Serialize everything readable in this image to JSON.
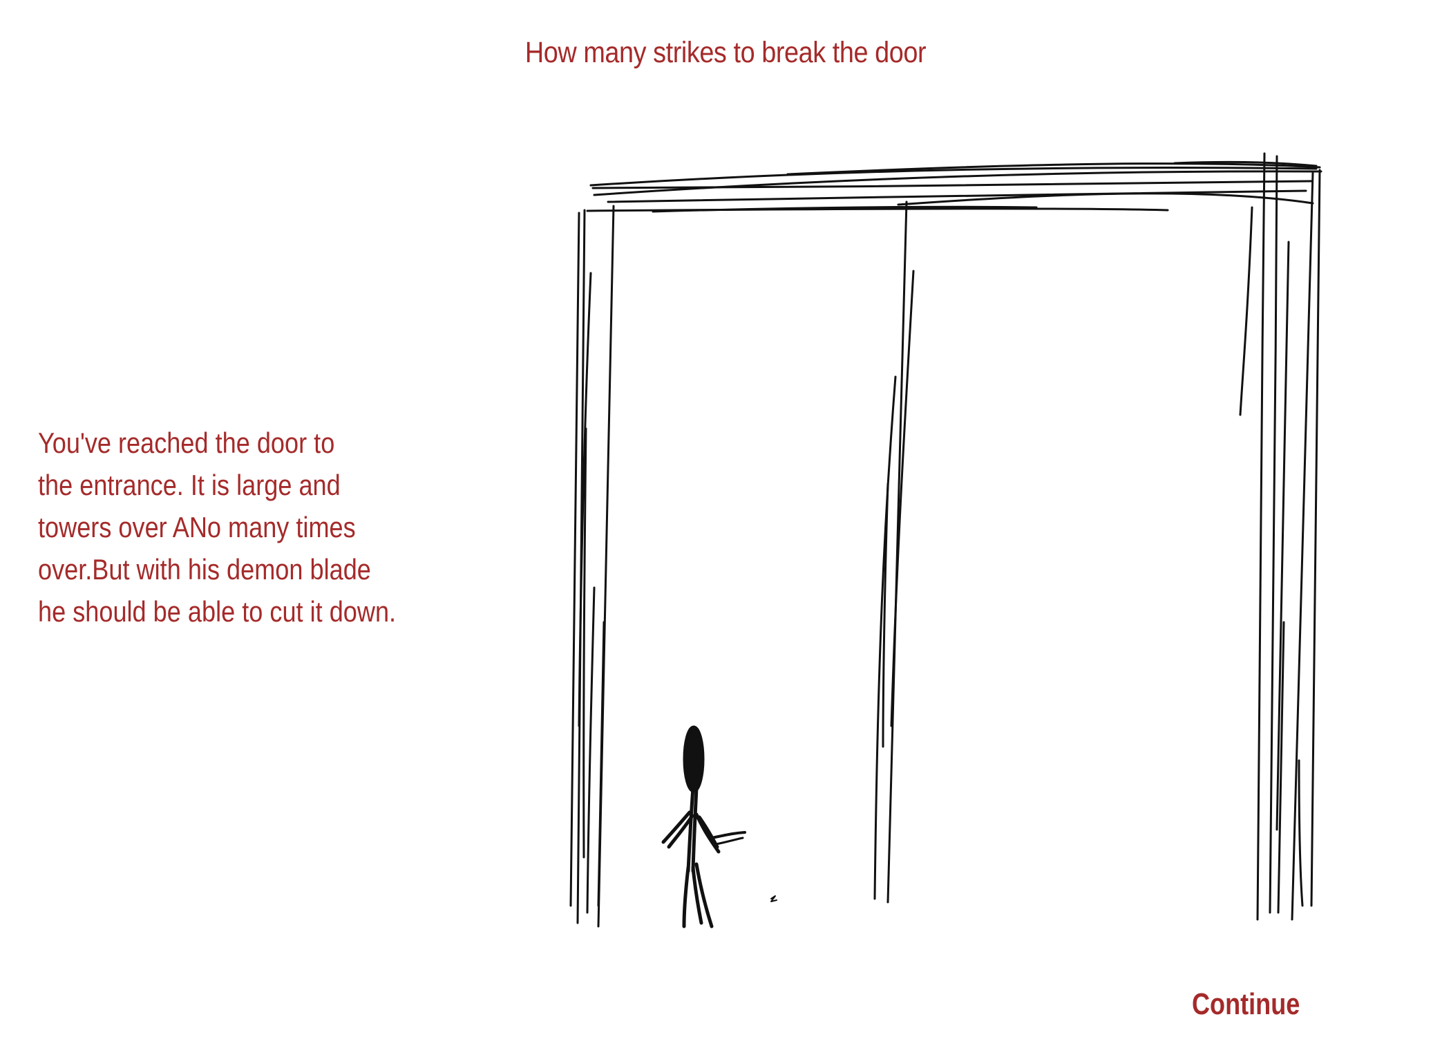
{
  "title": "How many strikes to break the door",
  "narrative": {
    "lines": [
      "You've reached the door to",
      "the entrance. It is large and",
      "towers over ANo many times",
      "over.But with his demon blade",
      "he should be able to cut it down."
    ]
  },
  "continue_label": "Continue",
  "colors": {
    "text": "#a52a2a",
    "ink": "#111111",
    "background": "#ffffff"
  }
}
